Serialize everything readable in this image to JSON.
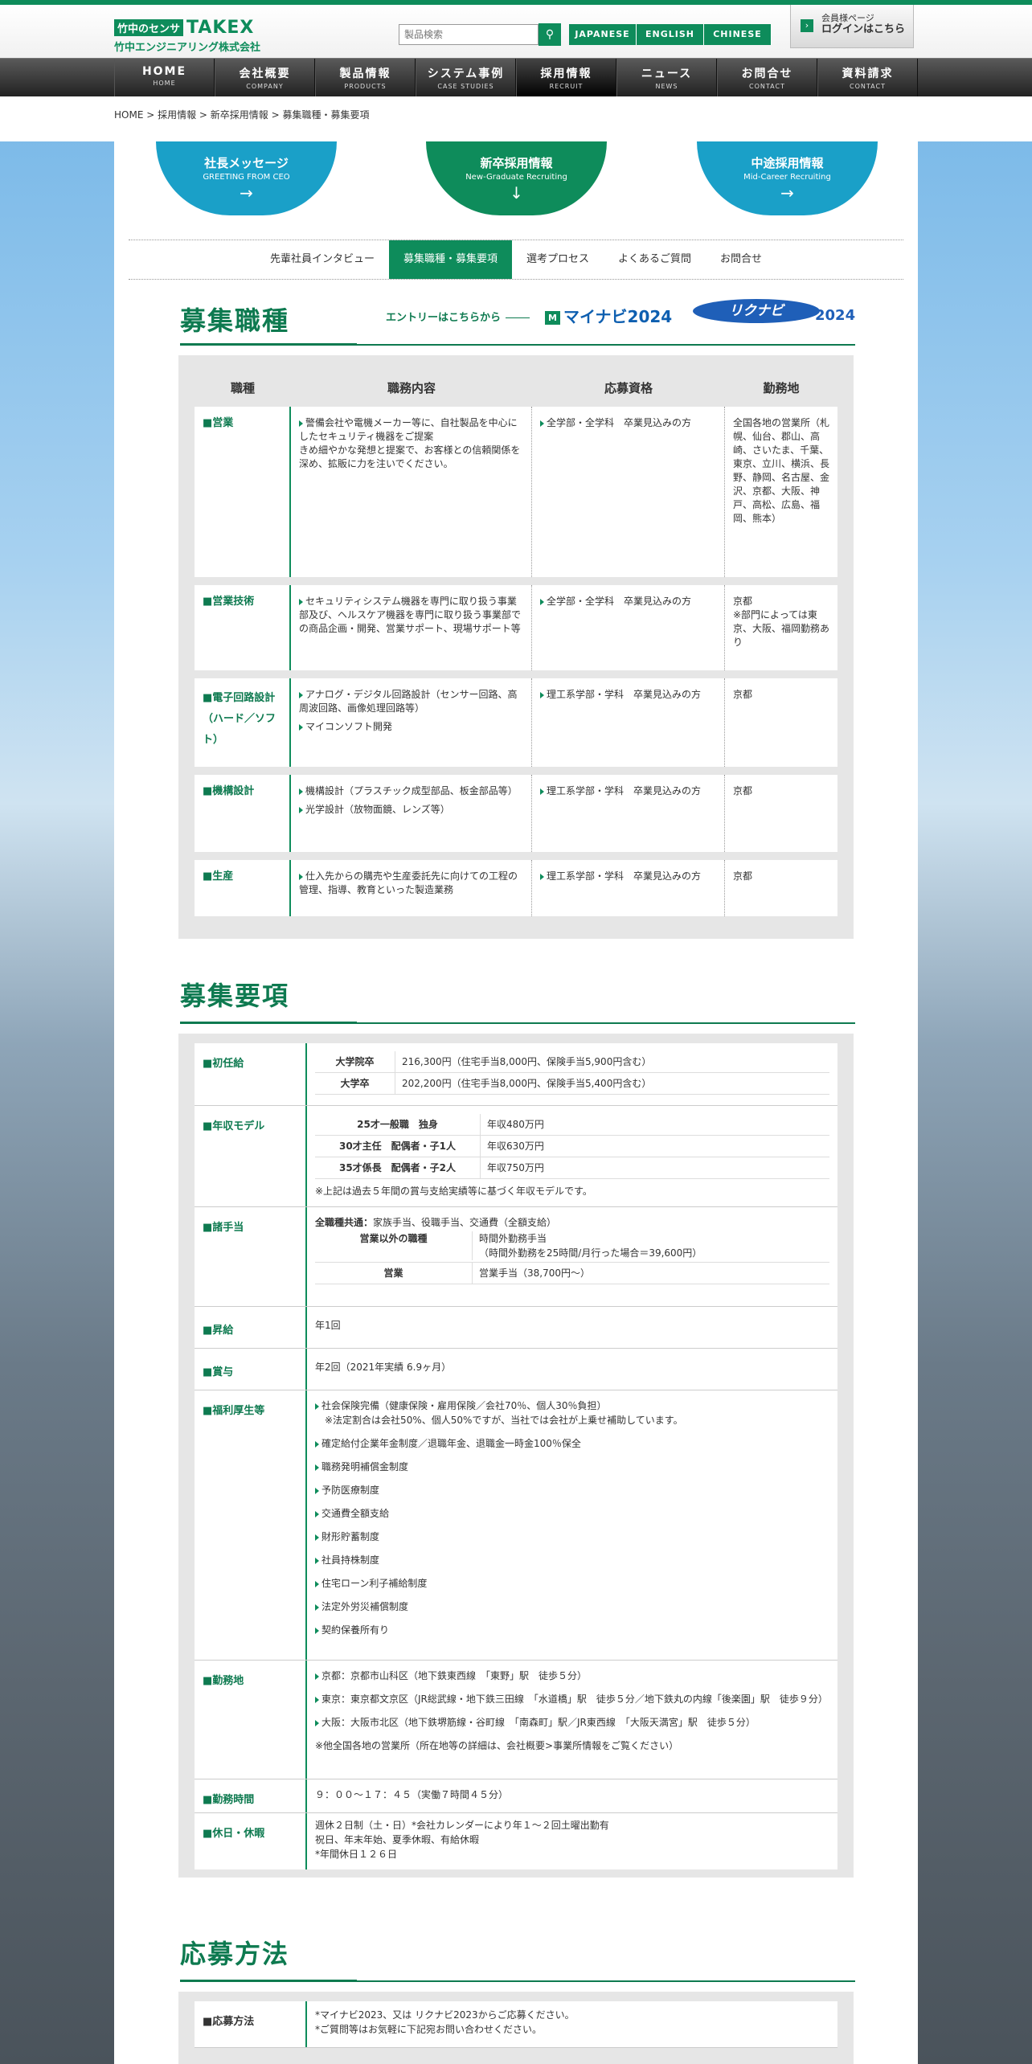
{
  "header": {
    "logo_badge": "竹中のセンサ",
    "logo_brand": "TAKEX",
    "company": "竹中エンジニアリング株式会社",
    "search_placeholder": "製品検索",
    "langs": [
      "JAPANESE",
      "ENGLISH",
      "CHINESE"
    ],
    "member_line1": "会員様ページ",
    "member_line2": "ログインはこちら"
  },
  "nav": [
    {
      "jp": "HOME",
      "en": "HOME"
    },
    {
      "jp": "会社概要",
      "en": "COMPANY"
    },
    {
      "jp": "製品情報",
      "en": "PRODUCTS"
    },
    {
      "jp": "システム事例",
      "en": "CASE STUDIES"
    },
    {
      "jp": "採用情報",
      "en": "RECRUIT"
    },
    {
      "jp": "ニュース",
      "en": "NEWS"
    },
    {
      "jp": "お問合せ",
      "en": "CONTACT"
    },
    {
      "jp": "資料請求",
      "en": "CONTACT"
    }
  ],
  "breadcrumb": "HOME > 採用情報 > 新卒採用情報 > 募集職種・募集要項",
  "hero": [
    {
      "title": "社長メッセージ",
      "sub": "GREETING FROM CEO",
      "arrow": "→"
    },
    {
      "title": "新卒採用情報",
      "sub": "New-Graduate Recruiting",
      "arrow": "↓"
    },
    {
      "title": "中途採用情報",
      "sub": "Mid-Career Recruiting",
      "arrow": "→"
    }
  ],
  "subnav": [
    "先輩社員インタビュー",
    "募集職種・募集要項",
    "選考プロセス",
    "よくあるご質問",
    "お問合せ"
  ],
  "jobs": {
    "title": "募集職種",
    "entry": "エントリーはこちらから",
    "mynavi_mark": "M",
    "mynavi": "マイナビ2024",
    "rikunabi": "リクナビ",
    "rikunabi_year": "2024",
    "headers": [
      "職種",
      "職務内容",
      "応募資格",
      "勤務地"
    ],
    "rows": [
      {
        "name": "■営業",
        "duties": [
          "警備会社や電機メーカー等に、自社製品を中心にしたセキュリティ機器をご提案\nきめ細やかな発想と提案で、お客様との信頼関係を深め、拡販に力を注いでください。"
        ],
        "qual": "全学部・全学科　卒業見込みの方",
        "loc": "全国各地の営業所（札幌、仙台、郡山、高崎、さいたま、千葉、東京、立川、横浜、長野、静岡、名古屋、金沢、京都、大阪、神戸、高松、広島、福岡、熊本）"
      },
      {
        "name": "■営業技術",
        "duties": [
          "セキュリティシステム機器を専門に取り扱う事業部及び、ヘルスケア機器を専門に取り扱う事業部での商品企画・開発、営業サポート、現場サポート等"
        ],
        "qual": "全学部・全学科　卒業見込みの方",
        "loc": "京都\n※部門によっては東京、大阪、福岡勤務あり"
      },
      {
        "name": "■電子回路設計（ハード／ソフト）",
        "duties": [
          "アナログ・デジタル回路設計（センサー回路、高周波回路、画像処理回路等）",
          "マイコンソフト開発"
        ],
        "qual": "理工系学部・学科　卒業見込みの方",
        "loc": "京都"
      },
      {
        "name": "■機構設計",
        "duties": [
          "機構設計（プラスチック成型部品、板金部品等）",
          "光学設計（放物面鏡、レンズ等）"
        ],
        "qual": "理工系学部・学科　卒業見込みの方",
        "loc": "京都"
      },
      {
        "name": "■生産",
        "duties": [
          "仕入先からの購売や生産委託先に向けての工程の管理、指導、教育といった製造業務"
        ],
        "qual": "理工系学部・学科　卒業見込みの方",
        "loc": "京都"
      }
    ]
  },
  "terms": {
    "title": "募集要項",
    "salary_label": "■初任給",
    "salary": [
      {
        "k": "大学院卒",
        "v": "216,300円（住宅手当8,000円、保険手当5,900円含む）"
      },
      {
        "k": "大学卒",
        "v": "202,200円（住宅手当8,000円、保険手当5,400円含む）"
      }
    ],
    "annual_label": "■年収モデル",
    "annual": [
      {
        "k": "25才一般職　独身",
        "v": "年収480万円"
      },
      {
        "k": "30才主任　配偶者・子1人",
        "v": "年収630万円"
      },
      {
        "k": "35才係長　配偶者・子2人",
        "v": "年収750万円"
      }
    ],
    "annual_note": "※上記は過去５年間の賞与支給実績等に基づく年収モデルです。",
    "allow_label": "■諸手当",
    "allow_common_k": "全職種共通：",
    "allow_common_v": "家族手当、役職手当、交通費（全額支給）",
    "allow": [
      {
        "k": "営業以外の職種",
        "v": "時間外勤務手当\n（時間外勤務を25時間/月行った場合＝39,600円）"
      },
      {
        "k": "営業",
        "v": "営業手当（38,700円〜）"
      }
    ],
    "raise_label": "■昇給",
    "raise": "年1回",
    "bonus_label": "■賞与",
    "bonus": "年2回（2021年実績 6.9ヶ月）",
    "welfare_label": "■福利厚生等",
    "welfare": [
      "社会保険完備（健康保険・雇用保険／会社70％、個人30％負担）\n　※法定割合は会社50%、個人50%ですが、当社では会社が上乗せ補助しています。",
      "確定給付企業年金制度／退職年金、退職金一時金100％保全",
      "職務発明補償金制度",
      "予防医療制度",
      "交通費全額支給",
      "財形貯蓄制度",
      "社員持株制度",
      "住宅ローン利子補給制度",
      "法定外労災補償制度",
      "契約保養所有り"
    ],
    "office_label": "■勤務地",
    "office": [
      "京都：京都市山科区（地下鉄東西線　「東野」駅　徒歩５分）",
      "東京：東京都文京区（JR総武線・地下鉄三田線　「水道橋」駅　徒歩５分／地下鉄丸の内線「後楽園」駅　徒歩９分）",
      "大阪：大阪市北区（地下鉄堺筋線・谷町線　「南森町」駅／JR東西線　「大阪天満宮」駅　徒歩５分）"
    ],
    "office_note": "※他全国各地の営業所（所在地等の詳細は、会社概要>事業所情報をご覧ください）",
    "hours_label": "■勤務時間",
    "hours": "９：００〜１７：４５（実働７時間４５分）",
    "holiday_label": "■休日・休暇",
    "holiday": "週休２日制（土・日）*会社カレンダーにより年１〜２回土曜出勤有\n祝日、年末年始、夏季休暇、有給休暇\n*年間休日１２６日"
  },
  "apply": {
    "title": "応募方法",
    "label": "■応募方法",
    "value": "*マイナビ2023、又は リクナビ2023からご応募ください。\n*ご質問等はお気軽に下記宛お問い合わせください。"
  }
}
